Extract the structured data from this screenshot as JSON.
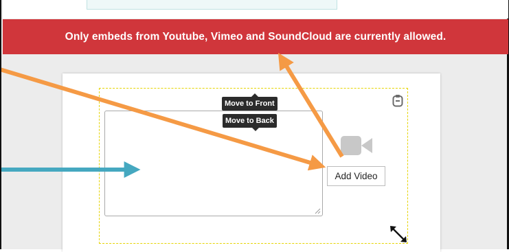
{
  "banner": {
    "message": "Only embeds from Youtube, Vimeo and SoundCloud are currently allowed."
  },
  "tooltips": {
    "move_to_front": "Move to Front",
    "move_to_back": "Move to Back"
  },
  "embed_widget": {
    "add_video_label": "Add Video",
    "icons": [
      "clipboard-icon",
      "video-camera-icon",
      "resize-icon",
      "textarea-resize-grip-icon"
    ]
  },
  "annotations": {
    "arrow_colors": {
      "orange": "#f59a45",
      "blue": "#45a8c0"
    }
  },
  "colors": {
    "banner_background": "#d0363b",
    "banner_text": "#ffffff",
    "selection_dashed_border": "#e6d400",
    "tooltip_background": "#2b2b2b",
    "icon_gray": "#c8c8c8"
  }
}
